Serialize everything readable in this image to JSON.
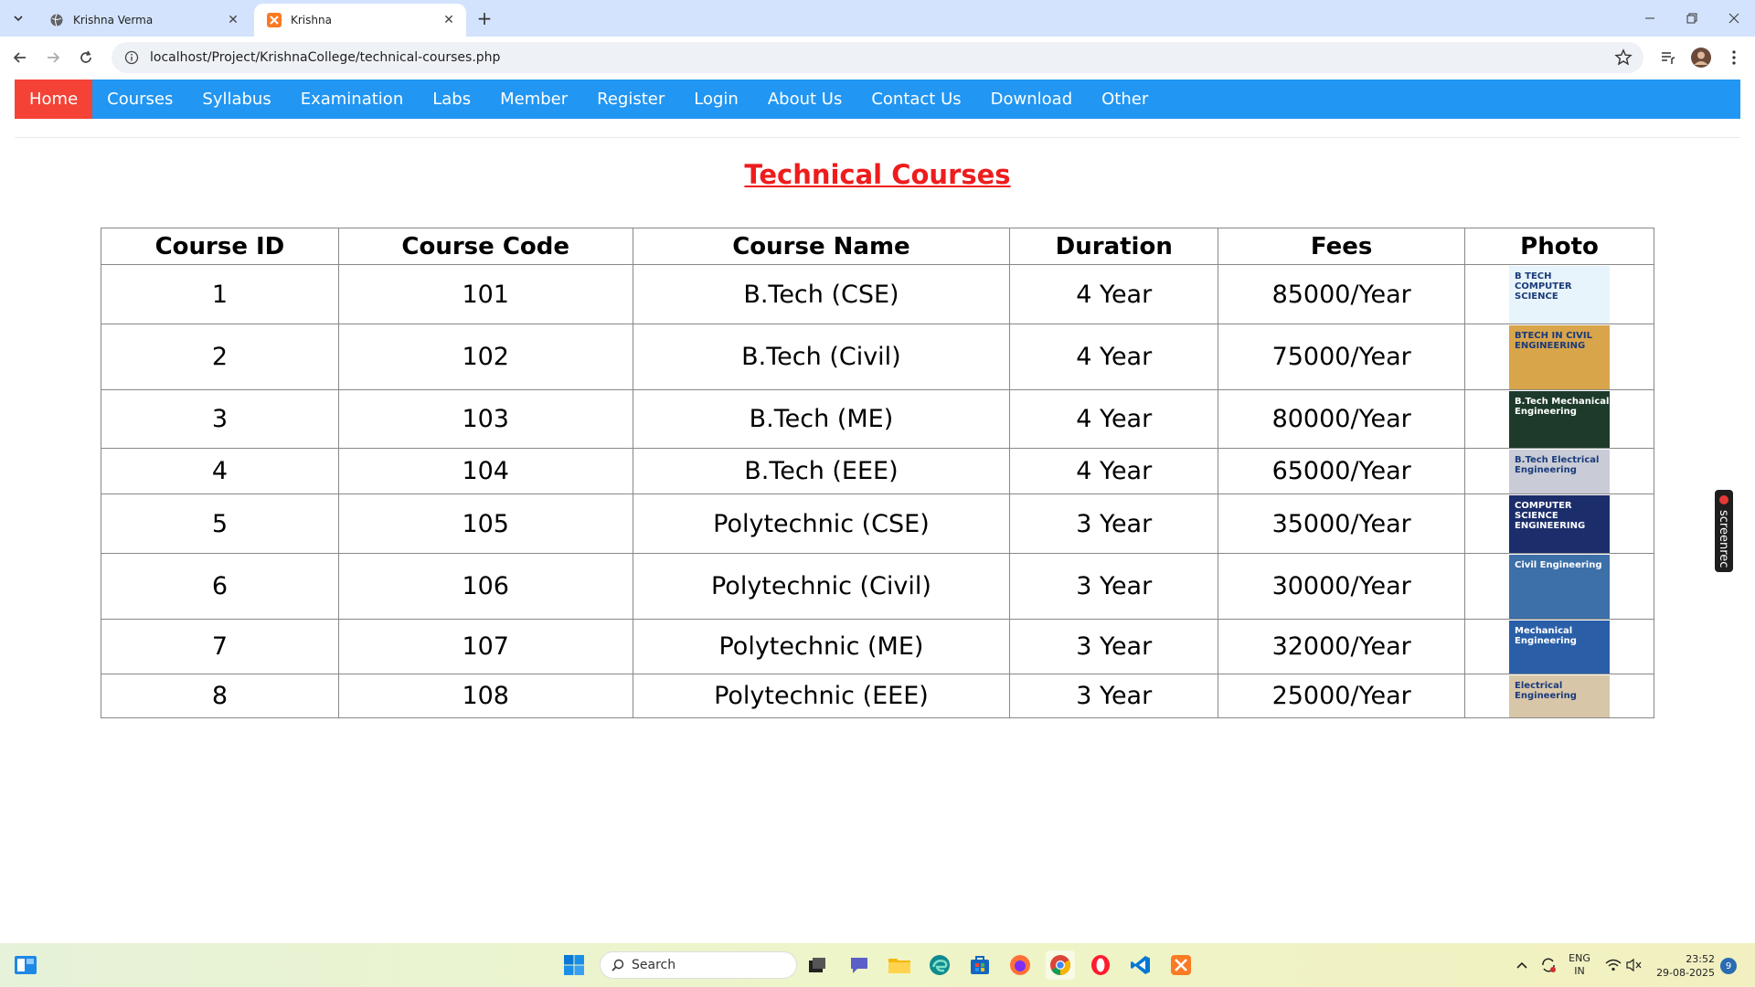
{
  "browser": {
    "tabs": [
      {
        "title": "Krishna Verma",
        "active": false
      },
      {
        "title": "Krishna",
        "active": true
      }
    ],
    "url": "localhost/Project/KrishnaCollege/technical-courses.php",
    "colors": {
      "tabstrip": "#d3e3fd",
      "omnibox": "#eef1f6"
    }
  },
  "site_nav": {
    "items": [
      "Home",
      "Courses",
      "Syllabus",
      "Examination",
      "Labs",
      "Member",
      "Register",
      "Login",
      "About Us",
      "Contact Us",
      "Download",
      "Other"
    ],
    "active_index": 0,
    "colors": {
      "bar": "#2196f3",
      "active": "#f44336"
    }
  },
  "page": {
    "title": "Technical Courses",
    "title_color": "#ee1c1c"
  },
  "table": {
    "headers": [
      "Course ID",
      "Course Code",
      "Course Name",
      "Duration",
      "Fees",
      "Photo"
    ],
    "rows": [
      {
        "id": "1",
        "code": "101",
        "name": "B.Tech (CSE)",
        "duration": "4 Year",
        "fees": "85000/Year",
        "photo_text": "B TECH COMPUTER SCIENCE",
        "photo_color": "#e8f4fb"
      },
      {
        "id": "2",
        "code": "102",
        "name": "B.Tech (Civil)",
        "duration": "4 Year",
        "fees": "75000/Year",
        "photo_text": "BTECH IN CIVIL ENGINEERING",
        "photo_color": "#d9a54a"
      },
      {
        "id": "3",
        "code": "103",
        "name": "B.Tech (ME)",
        "duration": "4 Year",
        "fees": "80000/Year",
        "photo_text": "B.Tech Mechanical Engineering",
        "photo_color": "#1d3a2a"
      },
      {
        "id": "4",
        "code": "104",
        "name": "B.Tech (EEE)",
        "duration": "4 Year",
        "fees": "65000/Year",
        "photo_text": "B.Tech Electrical Engineering",
        "photo_color": "#c9ccd6"
      },
      {
        "id": "5",
        "code": "105",
        "name": "Polytechnic (CSE)",
        "duration": "3 Year",
        "fees": "35000/Year",
        "photo_text": "COMPUTER SCIENCE ENGINEERING",
        "photo_color": "#1b2d6b"
      },
      {
        "id": "6",
        "code": "106",
        "name": "Polytechnic (Civil)",
        "duration": "3 Year",
        "fees": "30000/Year",
        "photo_text": "Civil Engineering",
        "photo_color": "#3d6fa8"
      },
      {
        "id": "7",
        "code": "107",
        "name": "Polytechnic (ME)",
        "duration": "3 Year",
        "fees": "32000/Year",
        "photo_text": "Mechanical Engineering",
        "photo_color": "#2a5fa8"
      },
      {
        "id": "8",
        "code": "108",
        "name": "Polytechnic (EEE)",
        "duration": "3 Year",
        "fees": "25000/Year",
        "photo_text": "Electrical Engineering",
        "photo_color": "#d8c6a8"
      }
    ]
  },
  "screenrec": {
    "label": "screenrec"
  },
  "taskbar": {
    "search_placeholder": "Search",
    "tray_lang_line1": "ENG",
    "tray_lang_line2": "IN",
    "time": "23:52",
    "date": "29-08-2025",
    "notification_count": "9"
  }
}
